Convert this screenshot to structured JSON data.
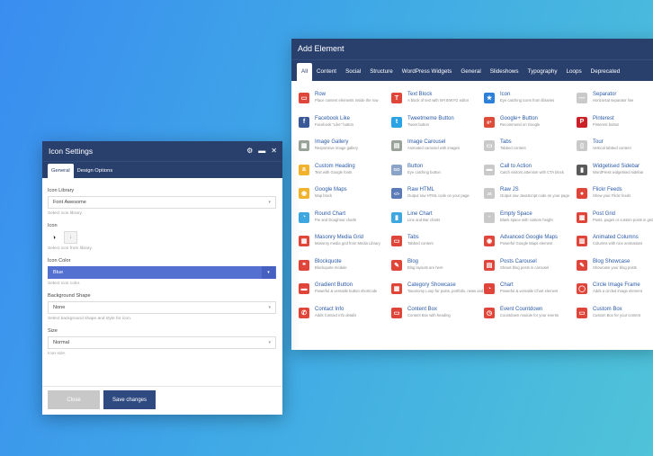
{
  "add_element": {
    "title": "Add Element",
    "tabs": [
      {
        "label": "All",
        "active": true
      },
      {
        "label": "Content"
      },
      {
        "label": "Social"
      },
      {
        "label": "Structure"
      },
      {
        "label": "WordPress Widgets"
      },
      {
        "label": "General"
      },
      {
        "label": "Slideshows"
      },
      {
        "label": "Typography"
      },
      {
        "label": "Loops"
      },
      {
        "label": "Deprecated"
      }
    ],
    "items": [
      {
        "name": "Row",
        "desc": "Place content elements inside the row",
        "icon": "row-icon",
        "glyph": "▭",
        "color": "#e0453a"
      },
      {
        "name": "Text Block",
        "desc": "A block of text with WYSIWYG editor",
        "icon": "text-block-icon",
        "glyph": "T",
        "color": "#e0453a"
      },
      {
        "name": "Icon",
        "desc": "Eye catching icons from libraries",
        "icon": "icon-element-icon",
        "glyph": "★",
        "color": "#2d7fd8"
      },
      {
        "name": "Separator",
        "desc": "Horizontal separator line",
        "icon": "separator-icon",
        "glyph": "—",
        "color": "#c9c9c9"
      },
      {
        "name": "Facebook Like",
        "desc": "Facebook \"Like\" button",
        "icon": "facebook-icon",
        "glyph": "f",
        "color": "#3b5998"
      },
      {
        "name": "Tweetmeme Button",
        "desc": "Tweet button",
        "icon": "twitter-icon",
        "glyph": "t",
        "color": "#2aa3e5"
      },
      {
        "name": "Google+ Button",
        "desc": "Recommend on Google",
        "icon": "google-plus-icon",
        "glyph": "g+",
        "color": "#dd4b39"
      },
      {
        "name": "Pinterest",
        "desc": "Pinterest button",
        "icon": "pinterest-icon",
        "glyph": "P",
        "color": "#cb2027"
      },
      {
        "name": "Image Gallery",
        "desc": "Responsive image gallery",
        "icon": "image-gallery-icon",
        "glyph": "▦",
        "color": "#9aa39a"
      },
      {
        "name": "Image Carousel",
        "desc": "Animated carousel with images",
        "icon": "image-carousel-icon",
        "glyph": "▤",
        "color": "#9aa39a"
      },
      {
        "name": "Tabs",
        "desc": "Tabbed content",
        "icon": "tabs-icon",
        "glyph": "▭",
        "color": "#c9c9c9"
      },
      {
        "name": "Tour",
        "desc": "Vertical tabbed content",
        "icon": "tour-icon",
        "glyph": "▯",
        "color": "#c9c9c9"
      },
      {
        "name": "Custom Heading",
        "desc": "Text with Google fonts",
        "icon": "custom-heading-icon",
        "glyph": "a",
        "color": "#f0b32b"
      },
      {
        "name": "Button",
        "desc": "Eye catching button",
        "icon": "button-icon",
        "glyph": "GO",
        "color": "#8aa4c8"
      },
      {
        "name": "Call to Action",
        "desc": "Catch visitors attention with CTA block",
        "icon": "call-to-action-icon",
        "glyph": "▬",
        "color": "#c9c9c9"
      },
      {
        "name": "Widgetised Sidebar",
        "desc": "WordPress widgetised sidebar",
        "icon": "widgetised-sidebar-icon",
        "glyph": "▮",
        "color": "#5a5a5a"
      },
      {
        "name": "Google Maps",
        "desc": "Map block",
        "icon": "google-maps-icon",
        "glyph": "◉",
        "color": "#f0b32b"
      },
      {
        "name": "Raw HTML",
        "desc": "Output raw HTML code on your page",
        "icon": "raw-html-icon",
        "glyph": "</>",
        "color": "#5a7ab8"
      },
      {
        "name": "Raw JS",
        "desc": "Output raw JavaScript code on your page",
        "icon": "raw-js-icon",
        "glyph": "JS",
        "color": "#c9c9c9"
      },
      {
        "name": "Flickr Feeds",
        "desc": "Show your Flickr feeds",
        "icon": "flickr-icon",
        "glyph": "●",
        "color": "#e0453a"
      },
      {
        "name": "Round Chart",
        "desc": "Pie and Doughnut charts",
        "icon": "round-chart-icon",
        "glyph": "◔",
        "color": "#3fa7e0"
      },
      {
        "name": "Line Chart",
        "desc": "Line and Bar charts",
        "icon": "line-chart-icon",
        "glyph": "▮",
        "color": "#3fa7e0"
      },
      {
        "name": "Empty Space",
        "desc": "Blank space with custom height",
        "icon": "empty-space-icon",
        "glyph": "▫",
        "color": "#c9c9c9"
      },
      {
        "name": "Post Grid",
        "desc": "Posts, pages or custom posts in grid",
        "icon": "post-grid-icon",
        "glyph": "▦",
        "color": "#e0453a"
      },
      {
        "name": "Masonry Media Grid",
        "desc": "Masonry media grid from Media Library",
        "icon": "masonry-media-grid-icon",
        "glyph": "▦",
        "color": "#e0453a"
      },
      {
        "name": "Tabs",
        "desc": "Tabbed content",
        "icon": "tabs-icon-2",
        "glyph": "▭",
        "color": "#e0453a"
      },
      {
        "name": "Advanced Google Maps",
        "desc": "Powerful Google Maps element",
        "icon": "advanced-google-maps-icon",
        "glyph": "◉",
        "color": "#e0453a"
      },
      {
        "name": "Animated Columns",
        "desc": "Columns with nice animations",
        "icon": "animated-columns-icon",
        "glyph": "▥",
        "color": "#e0453a"
      },
      {
        "name": "Blockquote",
        "desc": "Blockquote module",
        "icon": "blockquote-icon",
        "glyph": "❝",
        "color": "#e0453a"
      },
      {
        "name": "Blog",
        "desc": "Blog layouts are here",
        "icon": "blog-icon",
        "glyph": "✎",
        "color": "#e0453a"
      },
      {
        "name": "Posts Carousel",
        "desc": "Shows blog posts in carousel",
        "icon": "posts-carousel-icon",
        "glyph": "▤",
        "color": "#e0453a"
      },
      {
        "name": "Blog Showcase",
        "desc": "Showcase your blog posts",
        "icon": "blog-showcase-icon",
        "glyph": "✎",
        "color": "#e0453a"
      },
      {
        "name": "Gradient Button",
        "desc": "Powerful & versatile button shortcode",
        "icon": "gradient-button-icon",
        "glyph": "▬",
        "color": "#e0453a"
      },
      {
        "name": "Category Showcase",
        "desc": "Taxonomy Loop for posts, portfolio, news and product categories",
        "icon": "category-showcase-icon",
        "glyph": "▦",
        "color": "#e0453a"
      },
      {
        "name": "Chart",
        "desc": "Powerful & versatile Chart element",
        "icon": "chart-icon",
        "glyph": "◔",
        "color": "#e0453a"
      },
      {
        "name": "Circle Image Frame",
        "desc": "Adds a circled image element",
        "icon": "circle-image-frame-icon",
        "glyph": "◯",
        "color": "#e0453a"
      },
      {
        "name": "Contact Info",
        "desc": "Adds Contact info details",
        "icon": "contact-info-icon",
        "glyph": "✆",
        "color": "#e0453a"
      },
      {
        "name": "Content Box",
        "desc": "Content Box with heading",
        "icon": "content-box-icon",
        "glyph": "▭",
        "color": "#e0453a"
      },
      {
        "name": "Event Countdown",
        "desc": "Countdown module for your events",
        "icon": "event-countdown-icon",
        "glyph": "◷",
        "color": "#e0453a"
      },
      {
        "name": "Custom Box",
        "desc": "Custom Box for your content",
        "icon": "custom-box-icon",
        "glyph": "▭",
        "color": "#e0453a"
      }
    ]
  },
  "icon_settings": {
    "title": "Icon Settings",
    "header_icons": [
      {
        "name": "gear-icon",
        "glyph": "⚙"
      },
      {
        "name": "minimize-icon",
        "glyph": "▬"
      },
      {
        "name": "close-icon",
        "glyph": "✕"
      }
    ],
    "tabs": [
      {
        "label": "General",
        "active": true
      },
      {
        "label": "Design Options"
      }
    ],
    "fields": {
      "icon_library": {
        "label": "Icon Library",
        "value": "Font Awesome",
        "hint": "Select icon library."
      },
      "icon": {
        "label": "Icon",
        "hint": "Select icon from library."
      },
      "icon_color": {
        "label": "Icon Color",
        "value": "Blue",
        "hint": "Select icon color."
      },
      "background_shape": {
        "label": "Background Shape",
        "value": "None",
        "hint": "Select background shape and style for icon."
      },
      "size": {
        "label": "Size",
        "value": "Normal",
        "hint": "Icon size."
      }
    },
    "buttons": {
      "close": "Close",
      "save": "Save changes"
    }
  },
  "colors": {
    "header_bg": "#29406d",
    "accent_blue": "#5470d1",
    "link_blue": "#2a5aa8"
  }
}
